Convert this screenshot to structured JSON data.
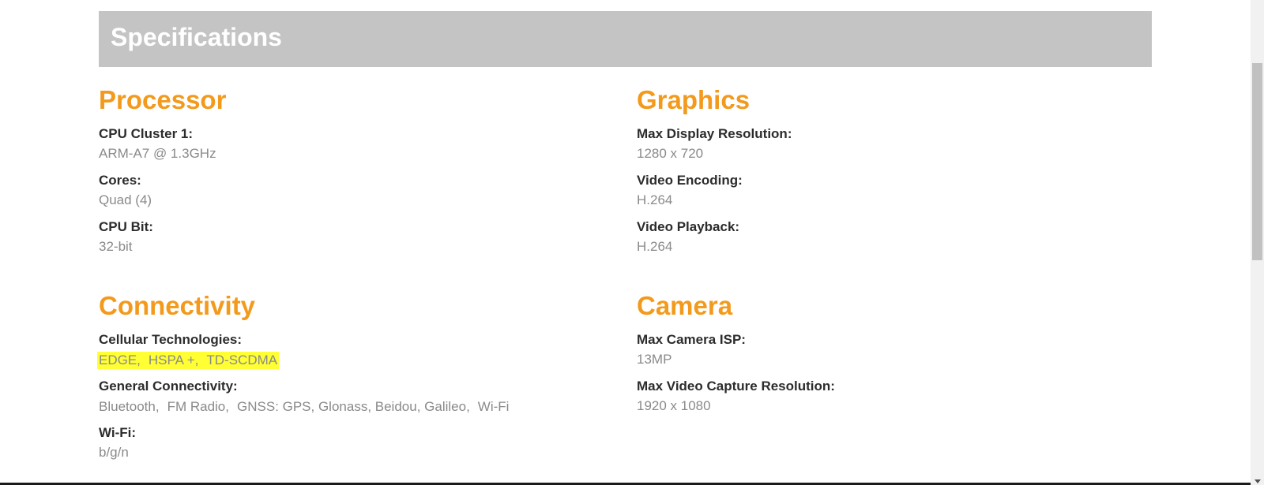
{
  "header": {
    "title": "Specifications"
  },
  "processor": {
    "title": "Processor",
    "items": [
      {
        "label": "CPU Cluster 1:",
        "value": "ARM-A7 @ 1.3GHz"
      },
      {
        "label": "Cores:",
        "value": "Quad (4)"
      },
      {
        "label": "CPU Bit:",
        "value": "32-bit"
      }
    ]
  },
  "graphics": {
    "title": "Graphics",
    "items": [
      {
        "label": "Max Display Resolution:",
        "value": "1280 x 720"
      },
      {
        "label": "Video Encoding:",
        "value": "H.264"
      },
      {
        "label": "Video Playback:",
        "value": "H.264"
      }
    ]
  },
  "connectivity": {
    "title": "Connectivity",
    "cellular_label": "Cellular Technologies:",
    "cellular_values": [
      "EDGE,",
      "HSPA +,",
      "TD-SCDMA"
    ],
    "general_label": "General Connectivity:",
    "general_values": [
      "Bluetooth,",
      "FM Radio,",
      "GNSS: GPS, Glonass, Beidou, Galileo,",
      "Wi-Fi"
    ],
    "wifi_label": "Wi-Fi:",
    "wifi_value": "b/g/n"
  },
  "camera": {
    "title": "Camera",
    "items": [
      {
        "label": "Max Camera ISP:",
        "value": "13MP"
      },
      {
        "label": "Max Video Capture Resolution:",
        "value": "1920 x 1080"
      }
    ]
  },
  "colors": {
    "accent": "#f39a1c",
    "banner": "#c4c4c4",
    "highlight": "#ffff33"
  },
  "icons": {
    "scroll_down": "chevron-down-icon"
  }
}
